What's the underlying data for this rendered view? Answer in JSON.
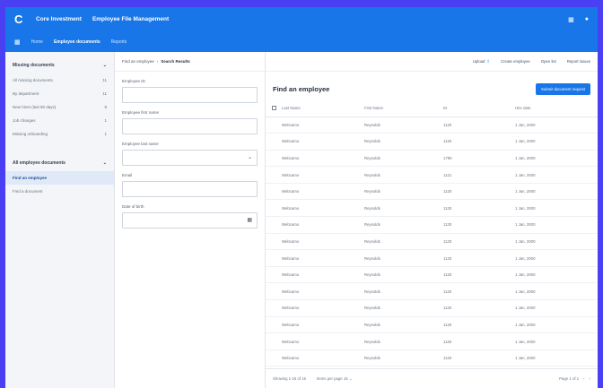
{
  "header": {
    "logo": "C",
    "company": "Core Investment",
    "app_name": "Employee File Management",
    "icons": [
      "grid-icon",
      "help-icon"
    ],
    "tabs": [
      {
        "label": "Home"
      },
      {
        "label": "Employee documents"
      },
      {
        "label": "Reports"
      }
    ],
    "active_tab": "Employee documents"
  },
  "sidebar": {
    "groups": [
      {
        "title": "Missing documents",
        "items": [
          {
            "label": "All missing documents",
            "count": "11"
          },
          {
            "label": "By department",
            "count": "11"
          },
          {
            "label": "New hires (last 90 days)",
            "count": "8"
          },
          {
            "label": "Job changes",
            "count": "1"
          },
          {
            "label": "Missing onboarding",
            "count": "1"
          }
        ]
      },
      {
        "title": "All employee documents",
        "items": [
          {
            "label": "Find an employee",
            "count": ""
          },
          {
            "label": "Find a document",
            "count": ""
          }
        ]
      }
    ]
  },
  "search": {
    "breadcrumb": [
      "Find an employee",
      "Search Results"
    ],
    "fields": [
      {
        "label": "Employee ID",
        "value": ""
      },
      {
        "label": "Employee first name",
        "value": ""
      },
      {
        "label": "Employee last name",
        "value": ""
      },
      {
        "label": "Email",
        "value": ""
      },
      {
        "label": "Date of birth",
        "value": ""
      }
    ]
  },
  "main": {
    "toolbar": {
      "upload": "Upload",
      "create": "Create employee",
      "open_list": "Open list",
      "report": "Report issues"
    },
    "title": "Find an employee",
    "primary_button": "Submit document request",
    "columns": [
      "Last Name",
      "First Name",
      "ID",
      "Hire date"
    ],
    "rows": [
      [
        "Webcamo",
        "Reynolds",
        "1120",
        "1 Jan, 2000"
      ],
      [
        "Webcamo",
        "Reynolds",
        "1120",
        "1 Jan, 2000"
      ],
      [
        "Webcamo",
        "Reynolds",
        "1790",
        "1 Jan, 2000"
      ],
      [
        "Webcamo",
        "Reynolds",
        "1121",
        "1 Jan, 2000"
      ],
      [
        "Webcamo",
        "Reynolds",
        "1120",
        "1 Jan, 2000"
      ],
      [
        "Webcamo",
        "Reynolds",
        "1120",
        "1 Jan, 2000"
      ],
      [
        "Webcamo",
        "Reynolds",
        "1120",
        "1 Jan, 2000"
      ],
      [
        "Webcamo",
        "Reynolds",
        "1120",
        "1 Jan, 2000"
      ],
      [
        "Webcamo",
        "Reynolds",
        "1120",
        "1 Jan, 2000"
      ],
      [
        "Webcamo",
        "Reynolds",
        "1120",
        "1 Jan, 2000"
      ],
      [
        "Webcamo",
        "Reynolds",
        "1120",
        "1 Jan, 2000"
      ],
      [
        "Webcamo",
        "Reynolds",
        "1120",
        "1 Jan, 2000"
      ],
      [
        "Webcamo",
        "Reynolds",
        "1120",
        "1 Jan, 2000"
      ],
      [
        "Webcamo",
        "Reynolds",
        "1120",
        "1 Jan, 2000"
      ],
      [
        "Webcamo",
        "Reynolds",
        "1120",
        "1 Jan, 2000"
      ]
    ],
    "footer": {
      "showing": "Showing 1-15 of 15",
      "per_page": "Items per page 15",
      "page": "Page 1 of 1"
    }
  },
  "colors": {
    "brand": "#1876e8",
    "backdrop": "#4a3ff2"
  }
}
